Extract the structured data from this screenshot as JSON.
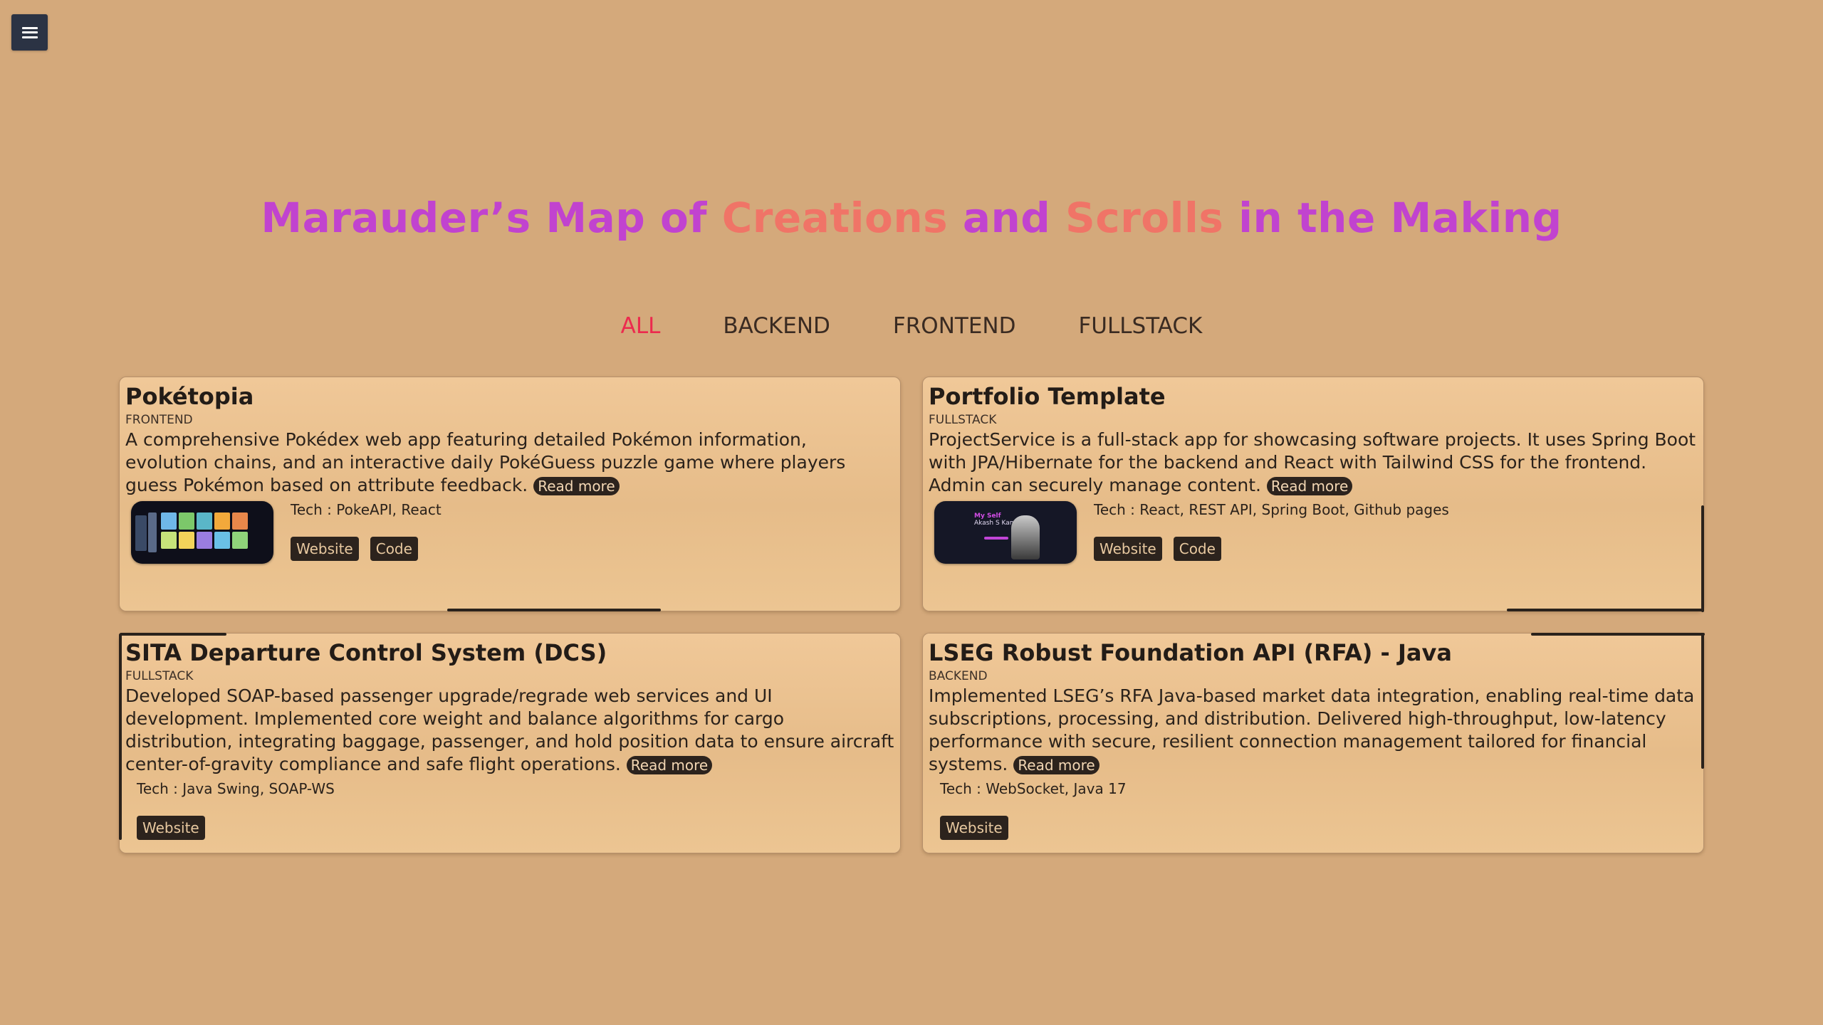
{
  "header": {
    "menu_icon": "hamburger-menu-icon",
    "title_parts": [
      "Marauder’s Map of ",
      "Creations",
      " and ",
      "Scrolls",
      " in the Making"
    ],
    "colors": {
      "primary": "#c143cf",
      "accent": "#f07467",
      "active_tab": "#ec2a4e",
      "background": "#d4a97b"
    }
  },
  "filters": [
    {
      "label": "ALL",
      "active": true
    },
    {
      "label": "BACKEND",
      "active": false
    },
    {
      "label": "FRONTEND",
      "active": false
    },
    {
      "label": "FULLSTACK",
      "active": false
    }
  ],
  "projects": [
    {
      "title": "Pokétopia",
      "category": "FRONTEND",
      "description": "A comprehensive Pokédex web app featuring detailed Pokémon information, evolution chains, and an interactive daily PokéGuess puzzle game where players guess Pokémon based on attribute feedback.",
      "read_more": "Read more",
      "tech": "Tech : PokeAPI, React",
      "website": "Website",
      "code": "Code"
    },
    {
      "title": "Portfolio Template",
      "category": "FULLSTACK",
      "description": "ProjectService is a full-stack app for showcasing software projects. It uses Spring Boot with JPA/Hibernate for the backend and React with Tailwind CSS for the frontend. Admin can securely manage content.",
      "read_more": "Read more",
      "tech": "Tech : React, REST API, Spring Boot, Github pages",
      "website": "Website",
      "code": "Code",
      "thumb_text_1": "My Self",
      "thumb_text_2": "Akash S Kamboran"
    },
    {
      "title": "SITA Departure Control System (DCS)",
      "category": "FULLSTACK",
      "description": "Developed SOAP-based passenger upgrade/regrade web services and UI development. Implemented core weight and balance algorithms for cargo distribution, integrating baggage, passenger, and hold position data to ensure aircraft center-of-gravity compliance and safe flight operations.",
      "read_more": "Read more",
      "tech": "Tech : Java Swing, SOAP-WS",
      "website": "Website"
    },
    {
      "title": "LSEG Robust Foundation API (RFA) - Java",
      "category": "BACKEND",
      "description": "Implemented LSEG’s RFA Java-based market data integration, enabling real-time data subscriptions, processing, and distribution. Delivered high-throughput, low-latency performance with secure, resilient connection management tailored for financial systems.",
      "read_more": "Read more",
      "tech": "Tech : WebSocket, Java 17",
      "website": "Website"
    }
  ]
}
